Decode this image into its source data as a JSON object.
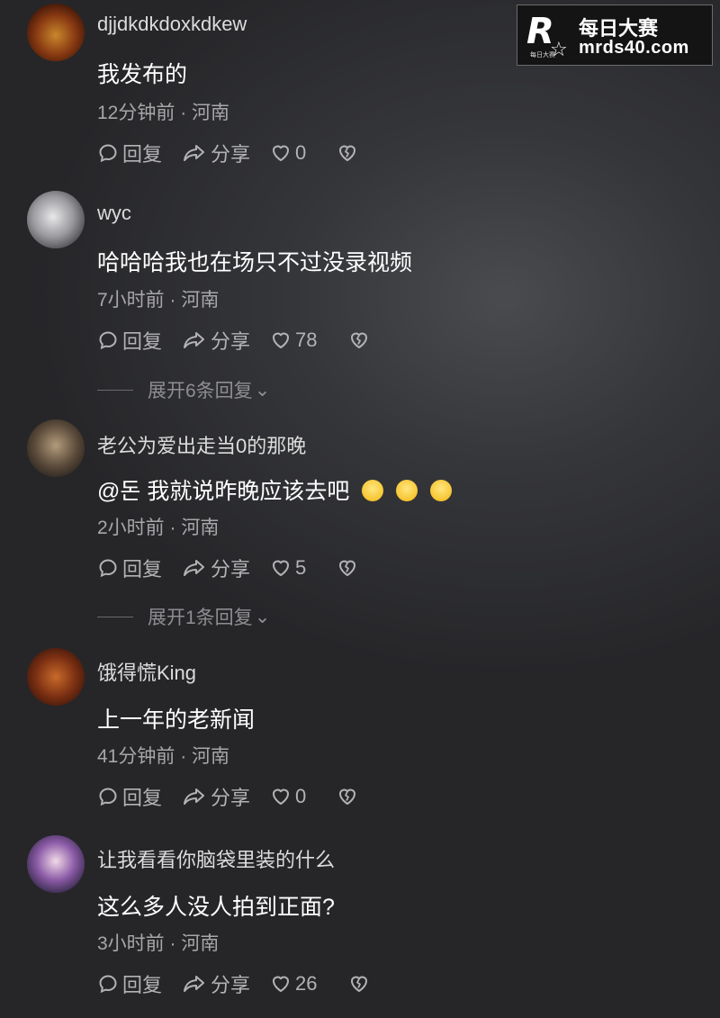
{
  "watermark": {
    "title": "每日大赛",
    "url": "mrds40.com",
    "logo_letter": "R",
    "logo_caption": "每日大赛"
  },
  "labels": {
    "reply": "回复",
    "share": "分享"
  },
  "icons": {
    "reply": "comment-bubble-icon",
    "share": "share-arrow-icon",
    "like": "heart-icon",
    "dislike": "broken-heart-icon"
  },
  "comments": [
    {
      "username": "djjdkdkdoxkdkew",
      "text": "我发布的",
      "meta": "12分钟前 · 河南",
      "likes": "0"
    },
    {
      "username": "wyc",
      "text": "哈哈哈我也在场只不过没录视频",
      "meta": "7小时前 · 河南",
      "likes": "78",
      "expand": "展开6条回复"
    },
    {
      "username": "老公为爱出走当0的那晚",
      "text": "@돈  我就说昨晚应该去吧",
      "emoji_count": 3,
      "meta": "2小时前 · 河南",
      "likes": "5",
      "expand": "展开1条回复"
    },
    {
      "username": "饿得慌King",
      "text": "上一年的老新闻",
      "meta": "41分钟前 · 河南",
      "likes": "0"
    },
    {
      "username": "让我看看你脑袋里装的什么",
      "text": "这么多人没人拍到正面?",
      "meta": "3小时前 · 河南",
      "likes": "26"
    }
  ]
}
